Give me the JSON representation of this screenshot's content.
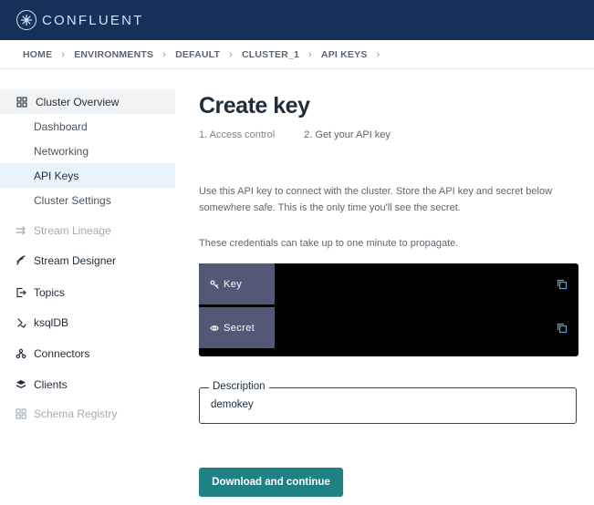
{
  "brand": {
    "name": "CONFLUENT",
    "color": "#17305a",
    "icon": "confluent-logo-icon"
  },
  "breadcrumb": [
    "HOME",
    "ENVIRONMENTS",
    "DEFAULT",
    "CLUSTER_1",
    "API KEYS"
  ],
  "sidebar": {
    "group": {
      "label": "Cluster Overview",
      "icon": "grid-icon"
    },
    "sub_items": [
      "Dashboard",
      "Networking",
      "API Keys",
      "Cluster Settings"
    ],
    "active_sub_item": "API Keys",
    "items": [
      {
        "label": "Stream Lineage",
        "icon": "lineage-icon",
        "disabled": true
      },
      {
        "label": "Stream Designer",
        "icon": "designer-icon",
        "disabled": false
      },
      {
        "label": "Topics",
        "icon": "topics-icon",
        "disabled": false
      },
      {
        "label": "ksqlDB",
        "icon": "ksqldb-icon",
        "disabled": false
      },
      {
        "label": "Connectors",
        "icon": "connectors-icon",
        "disabled": false
      },
      {
        "label": "Clients",
        "icon": "clients-icon",
        "disabled": false
      },
      {
        "label": "Schema Registry",
        "icon": "schema-registry-icon",
        "disabled": true
      }
    ]
  },
  "main": {
    "title": "Create key",
    "steps": [
      "1. Access control",
      "2. Get your API key"
    ],
    "intro": "Use this API key to connect with the cluster. Store the API key and secret below somewhere safe. This is the only time you'll see the secret.",
    "note": "These credentials can take up to one minute to propagate.",
    "credentials": [
      {
        "label": "Key",
        "icon": "key-icon",
        "value": "",
        "copy_icon": "copy-icon"
      },
      {
        "label": "Secret",
        "icon": "eye-icon",
        "value": "",
        "copy_icon": "copy-icon"
      }
    ],
    "description": {
      "label": "Description",
      "value": "demokey"
    },
    "primary_button": "Download and continue",
    "accent_color": "#1e8284"
  }
}
